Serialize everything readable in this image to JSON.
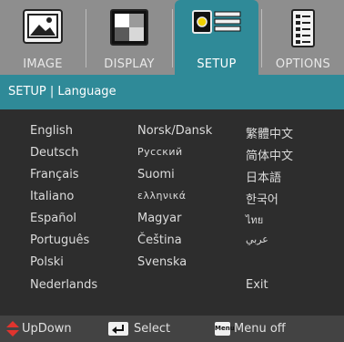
{
  "tabs": [
    {
      "label": "IMAGE",
      "icon": "image-icon"
    },
    {
      "label": "DISPLAY",
      "icon": "display-icon"
    },
    {
      "label": "SETUP",
      "icon": "setup-icon"
    },
    {
      "label": "OPTIONS",
      "icon": "options-icon"
    }
  ],
  "active_tab": "SETUP",
  "breadcrumb": "SETUP | Language",
  "languages": {
    "col1": [
      "English",
      "Deutsch",
      "Français",
      "Italiano",
      "Español",
      "Português",
      "Polski",
      "Nederlands"
    ],
    "col2": [
      "Norsk/Dansk",
      "Русский",
      "Suomi",
      "ελληνικά",
      "Magyar",
      "Čeština",
      "Svenska"
    ],
    "col3": [
      "繁體中文",
      "简体中文",
      "日本語",
      "한국어",
      "ไทย",
      "عربي"
    ]
  },
  "exit_label": "Exit",
  "footer": {
    "updown": "UpDown",
    "select": "Select",
    "menu_key": "Menu",
    "menu_off": "Menu off"
  },
  "colors": {
    "accent": "#2f8a98",
    "tabbar": "#8e8e8e",
    "panel": "#2d2d2d",
    "footer": "#434343",
    "arrow": "#e0342e"
  }
}
